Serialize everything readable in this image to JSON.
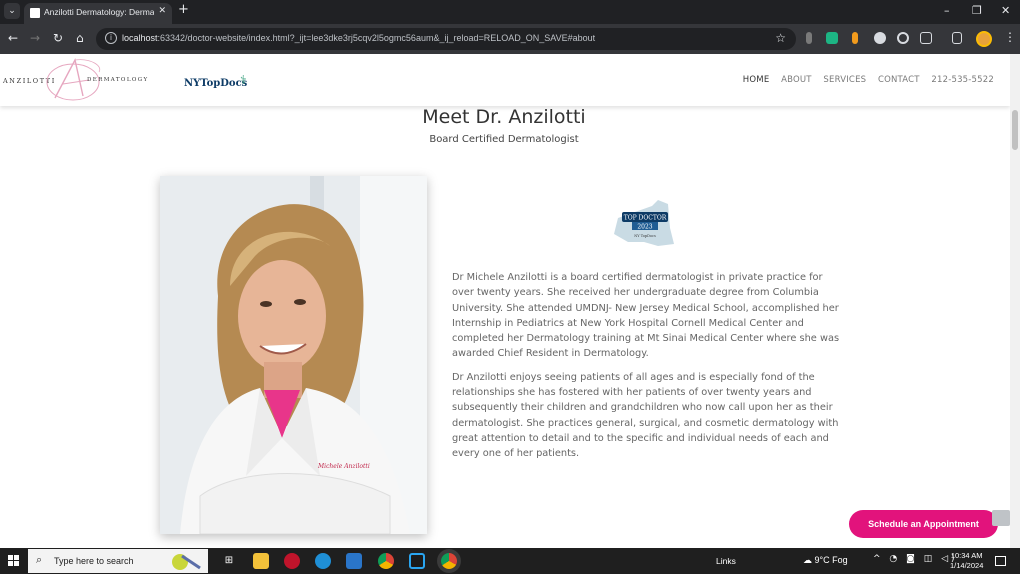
{
  "browser": {
    "tab_title": "Anzilotti Dermatology: Dermat",
    "url_host": "localhost",
    "url_rest": ":63342/doctor-website/index.html?_ijt=lee3dke3rj5cqv2l5ogmc56aum&_ij_reload=RELOAD_ON_SAVE#about",
    "window_controls": [
      "–",
      "❐",
      "✕"
    ]
  },
  "site": {
    "logo_left": "ANZILOTTI",
    "logo_right": "DERMATOLOGY",
    "logo_monogram": "A",
    "partner_logo": "NYTopDocs",
    "nav": [
      "HOME",
      "ABOUT",
      "SERVICES",
      "CONTACT",
      "212-535-5522"
    ]
  },
  "about": {
    "title": "Meet Dr. Anzilotti",
    "subtitle": "Board Certified Dermatologist",
    "portrait_signature": "Michele Anzilotti",
    "badge": {
      "line1": "TOP DOCTOR",
      "line2": "2023",
      "line3": "NY TopDocs"
    },
    "paragraphs": [
      "Dr Michele Anzilotti is a board certified dermatologist in private practice for over twenty years. She received her undergraduate degree from Columbia University. She attended UMDNJ- New Jersey Medical School, accomplished her Internship in Pediatrics at New York Hospital Cornell Medical Center and completed her Dermatology training at Mt Sinai Medical Center where she was awarded Chief Resident in Dermatology.",
      "Dr Anzilotti enjoys seeing patients of all ages and is especially fond of the relationships she has fostered with her patients of over twenty years and subsequently their children and grandchildren who now call upon her as their dermatologist. She practices general, surgical, and cosmetic dermatology with great attention to detail and to the specific and individual needs of each and every one of her patients."
    ],
    "cta": "Schedule an Appointment"
  },
  "taskbar": {
    "search_placeholder": "Type here to search",
    "links_label": "Links",
    "weather": "9°C  Fog",
    "time": "10:34 AM",
    "date": "1/14/2024"
  },
  "colors": {
    "accent": "#e2137c",
    "logo_pink": "#e6a6bf",
    "chrome_dark": "#202124",
    "chrome_mid": "#35363a"
  }
}
